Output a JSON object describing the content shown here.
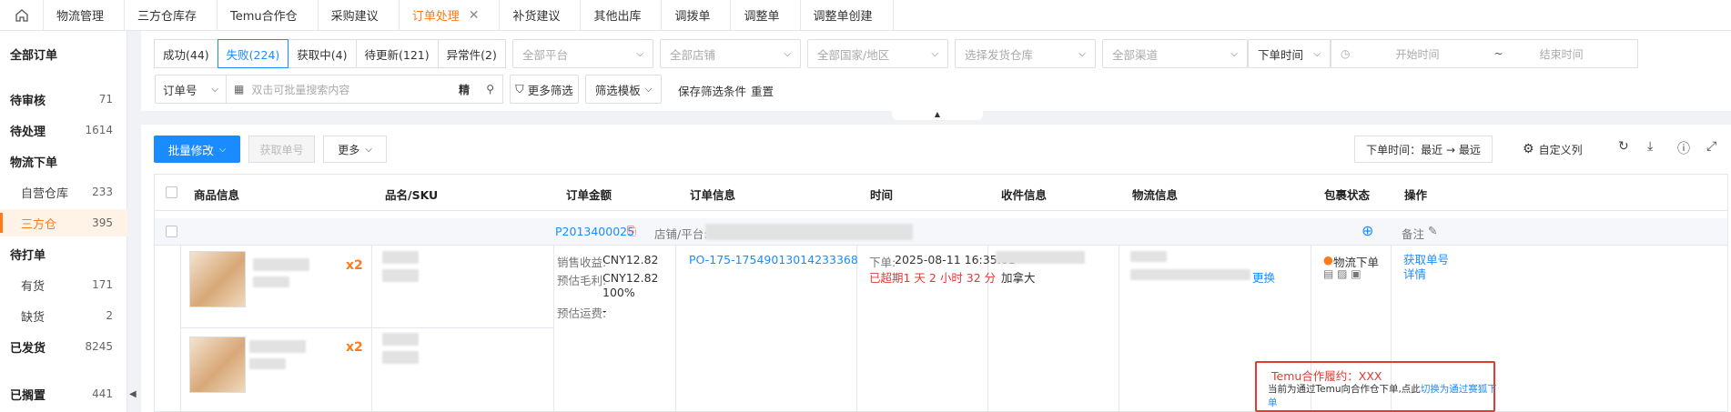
{
  "tabs": [
    "物流管理",
    "三方仓库存",
    "Temu合作仓",
    "采购建议",
    "订单处理",
    "补货建议",
    "其他出库",
    "调拨单",
    "调整单",
    "调整单创建"
  ],
  "active_tab": "订单处理",
  "sidebar": {
    "all": "全部订单",
    "items": [
      {
        "label": "待审核",
        "count": "71",
        "type": "group"
      },
      {
        "label": "待处理",
        "count": "1614",
        "type": "group"
      },
      {
        "label": "物流下单",
        "count": "",
        "type": "group"
      },
      {
        "label": "自营仓库",
        "count": "233",
        "type": "sub"
      },
      {
        "label": "三方仓",
        "count": "395",
        "type": "sub",
        "active": true
      },
      {
        "label": "待打单",
        "count": "",
        "type": "group"
      },
      {
        "label": "有货",
        "count": "171",
        "type": "sub"
      },
      {
        "label": "缺货",
        "count": "2",
        "type": "sub"
      },
      {
        "label": "已发货",
        "count": "8245",
        "type": "group"
      },
      {
        "label": "已搁置",
        "count": "441",
        "type": "group"
      }
    ]
  },
  "status_tabs": [
    "成功(44)",
    "失败(224)",
    "获取中(4)",
    "待更新(121)",
    "异常件(2)"
  ],
  "selects": {
    "platform": "全部平台",
    "store": "全部店铺",
    "country": "全部国家/地区",
    "warehouse": "选择发货仓库",
    "channel": "全部渠道",
    "time_type": "下单时间"
  },
  "date": {
    "start": "开始时间",
    "sep": "~",
    "end": "结束时间"
  },
  "search": {
    "field": "订单号",
    "placeholder": "双击可批量搜索内容",
    "exact": "精"
  },
  "actions": {
    "more_filter": "更多筛选",
    "template": "筛选模板",
    "save": "保存筛选条件",
    "reset": "重置"
  },
  "toolbar": {
    "batch": "批量修改",
    "fetch": "获取单号",
    "more": "更多",
    "sort": "下单时间：最近 → 最远",
    "custom_col": "自定义列"
  },
  "columns": [
    "商品信息",
    "品名/SKU",
    "订单金额",
    "订单信息",
    "时间",
    "收件信息",
    "物流信息",
    "包裹状态",
    "操作"
  ],
  "order": {
    "id": "P2013400025",
    "store_label": "店铺/平台:",
    "remark": "备注",
    "qty1": "x2",
    "qty2": "x2",
    "amount": {
      "sale_label": "销售收益:",
      "sale": "CNY12.82",
      "profit_label": "预估毛利:",
      "profit": "CNY12.82",
      "profit_pct": "100%",
      "ship_label": "预估运费:",
      "ship": "-"
    },
    "po": "PO-175-17549013014233368",
    "time_label": "下单:",
    "time": "2025-08-11 16:35:01",
    "overdue": "已超期1 天 2 小时 32 分",
    "country": "加拿大",
    "change": "更换",
    "logistics_title": "Temu合作履约：XXX",
    "logistics_note": "当前为通过Temu向合作仓下单,点此",
    "logistics_link": "切换为通过赛狐下单",
    "pkg_status": "物流下单",
    "op_fetch": "获取单号",
    "op_detail": "详情"
  }
}
